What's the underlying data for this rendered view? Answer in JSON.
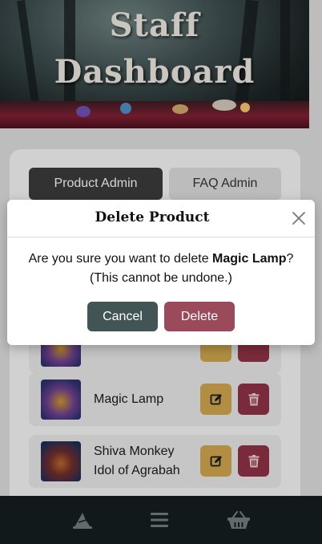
{
  "hero": {
    "title_line1": "Staff",
    "title_line2": "Dashboard"
  },
  "tabs": [
    {
      "label": "Product Admin",
      "active": true
    },
    {
      "label": "FAQ Admin",
      "active": false
    }
  ],
  "products": [
    {
      "name": "Magic Lamp"
    },
    {
      "name_line1": "Shiva Monkey",
      "name_line2": "Idol of Agrabah"
    }
  ],
  "modal": {
    "title": "Delete Product",
    "message_prefix": "Are you sure you want to delete ",
    "product_name": "Magic Lamp",
    "message_suffix": "?",
    "note": "(This cannot be undone.)",
    "cancel_label": "Cancel",
    "delete_label": "Delete"
  },
  "bottom_nav": {
    "items": [
      {
        "icon": "wizard-hat-icon"
      },
      {
        "icon": "menu-icon"
      },
      {
        "icon": "basket-icon"
      }
    ]
  },
  "colors": {
    "cancel": "#415456",
    "delete": "#9b4a5b",
    "edit": "#caa24a",
    "trash": "#8b3144",
    "nav_bg": "#12191b"
  }
}
